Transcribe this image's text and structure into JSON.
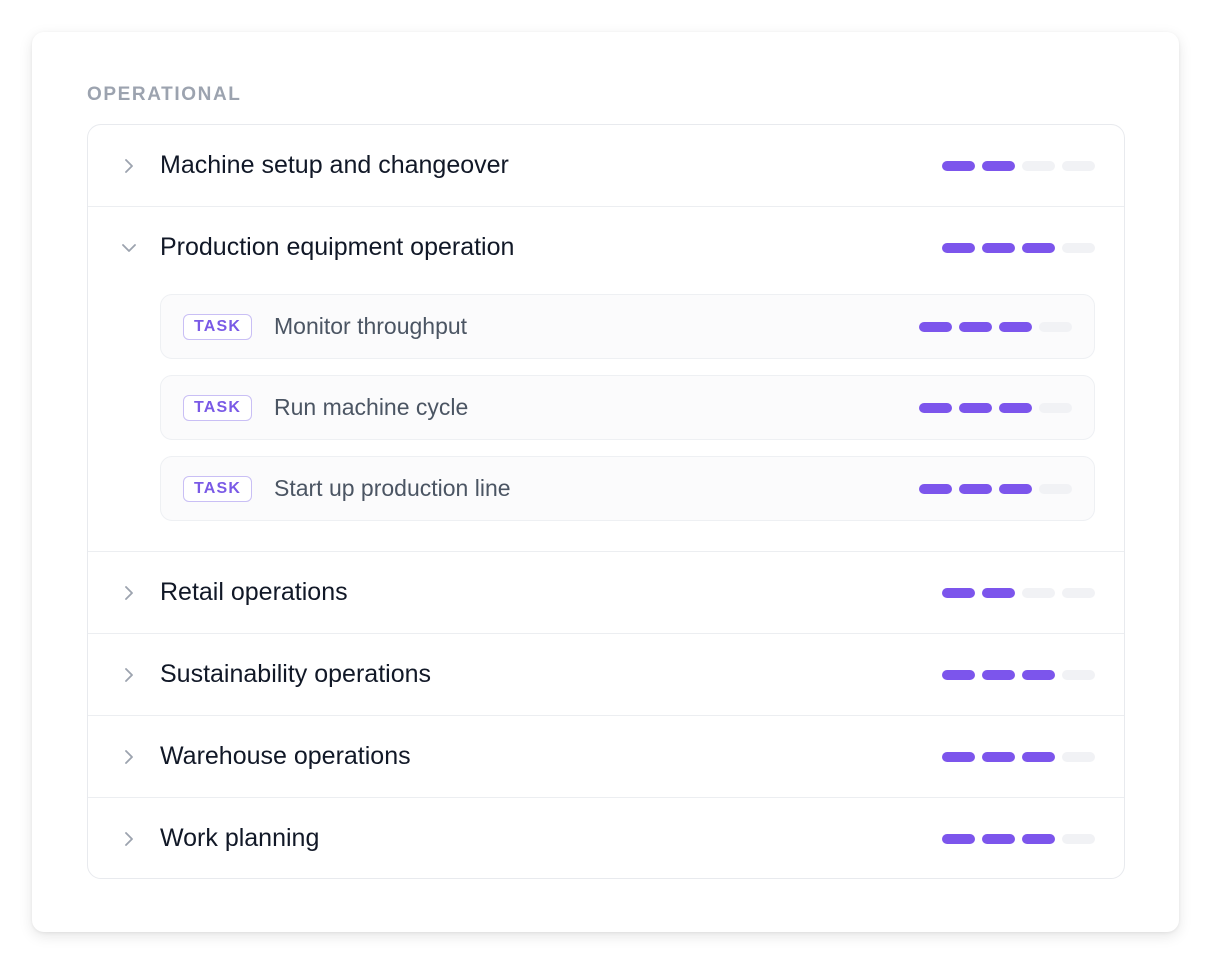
{
  "section": {
    "label": "OPERATIONAL"
  },
  "groups": [
    {
      "title": "Machine setup and changeover",
      "expanded": false,
      "level": 2,
      "level_max": 4,
      "chevron_icon": "chevron-right-icon",
      "tasks": []
    },
    {
      "title": "Production equipment operation",
      "expanded": true,
      "level": 3,
      "level_max": 4,
      "chevron_icon": "chevron-down-icon",
      "tasks": [
        {
          "badge": "TASK",
          "title": "Monitor throughput",
          "level": 3,
          "level_max": 4
        },
        {
          "badge": "TASK",
          "title": "Run machine cycle",
          "level": 3,
          "level_max": 4
        },
        {
          "badge": "TASK",
          "title": "Start up production line",
          "level": 3,
          "level_max": 4
        }
      ]
    },
    {
      "title": "Retail operations",
      "expanded": false,
      "level": 2,
      "level_max": 4,
      "chevron_icon": "chevron-right-icon",
      "tasks": []
    },
    {
      "title": "Sustainability operations",
      "expanded": false,
      "level": 3,
      "level_max": 4,
      "chevron_icon": "chevron-right-icon",
      "tasks": []
    },
    {
      "title": "Warehouse operations",
      "expanded": false,
      "level": 3,
      "level_max": 4,
      "chevron_icon": "chevron-right-icon",
      "tasks": []
    },
    {
      "title": "Work planning",
      "expanded": false,
      "level": 3,
      "level_max": 4,
      "chevron_icon": "chevron-right-icon",
      "tasks": []
    }
  ],
  "colors": {
    "accent": "#7c55ec",
    "segment_off": "#f1f2f5",
    "label_muted": "#9ca3af",
    "title_text": "#111827",
    "task_text": "#4b5563",
    "chevron": "#9ca3af"
  }
}
